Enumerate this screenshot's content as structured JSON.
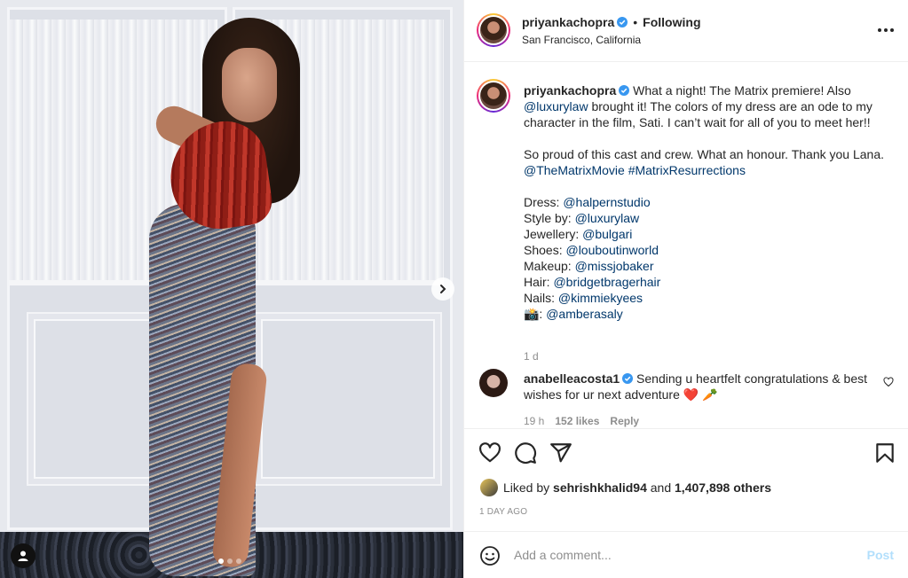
{
  "post": {
    "username": "priyankachopra",
    "separator": "•",
    "follow_status": "Following",
    "location": "San Francisco, California",
    "carousel_pages": 3,
    "carousel_current": 1
  },
  "caption": {
    "username": "priyankachopra",
    "line1_a": " What a night! The Matrix premiere! Also ",
    "mention_luxury": "@luxurylaw",
    "line1_b": " brought it! The colors of my dress are an ode to my character in the film, Sati. I can’t wait for all of you to meet her!!",
    "para2": "So proud of this cast and crew. What an honour. Thank you Lana.",
    "tag_movie": "@TheMatrixMovie",
    "tag_hash": "#MatrixResurrections",
    "credits": [
      {
        "label": "Dress: ",
        "handle": "@halpernstudio"
      },
      {
        "label": "Style by: ",
        "handle": "@luxurylaw"
      },
      {
        "label": "Jewellery: ",
        "handle": "@bulgari"
      },
      {
        "label": "Shoes: ",
        "handle": "@louboutinworld"
      },
      {
        "label": "Makeup: ",
        "handle": "@missjobaker"
      },
      {
        "label": "Hair: ",
        "handle": "@bridgetbragerhair"
      },
      {
        "label": "Nails: ",
        "handle": "@kimmiekyees"
      },
      {
        "label": "📸: ",
        "handle": "@amberasaly"
      }
    ],
    "time": "1 d"
  },
  "comment": {
    "username": "anabelleacosta1",
    "text": " Sending u heartfelt congratulations & best wishes for ur next adventure ❤️ 🥕",
    "time": "19 h",
    "likes": "152 likes",
    "reply": "Reply"
  },
  "actions": {
    "liked_by_prefix": "Liked by ",
    "liked_by_user": "sehrishkhalid94",
    "liked_by_and": " and ",
    "liked_by_count": "1,407,898 others",
    "post_date": "1 DAY AGO"
  },
  "add_comment": {
    "placeholder": "Add a comment...",
    "post_label": "Post"
  },
  "colors": {
    "link": "#00376b",
    "verified": "#3897f0",
    "muted": "#8e8e8e",
    "post_disabled": "#b2dffc"
  },
  "icons": [
    "chevron-right-icon",
    "tag-person-icon",
    "verified-badge-icon",
    "more-options-icon",
    "heart-icon",
    "comment-icon",
    "share-icon",
    "bookmark-icon",
    "emoji-icon"
  ]
}
